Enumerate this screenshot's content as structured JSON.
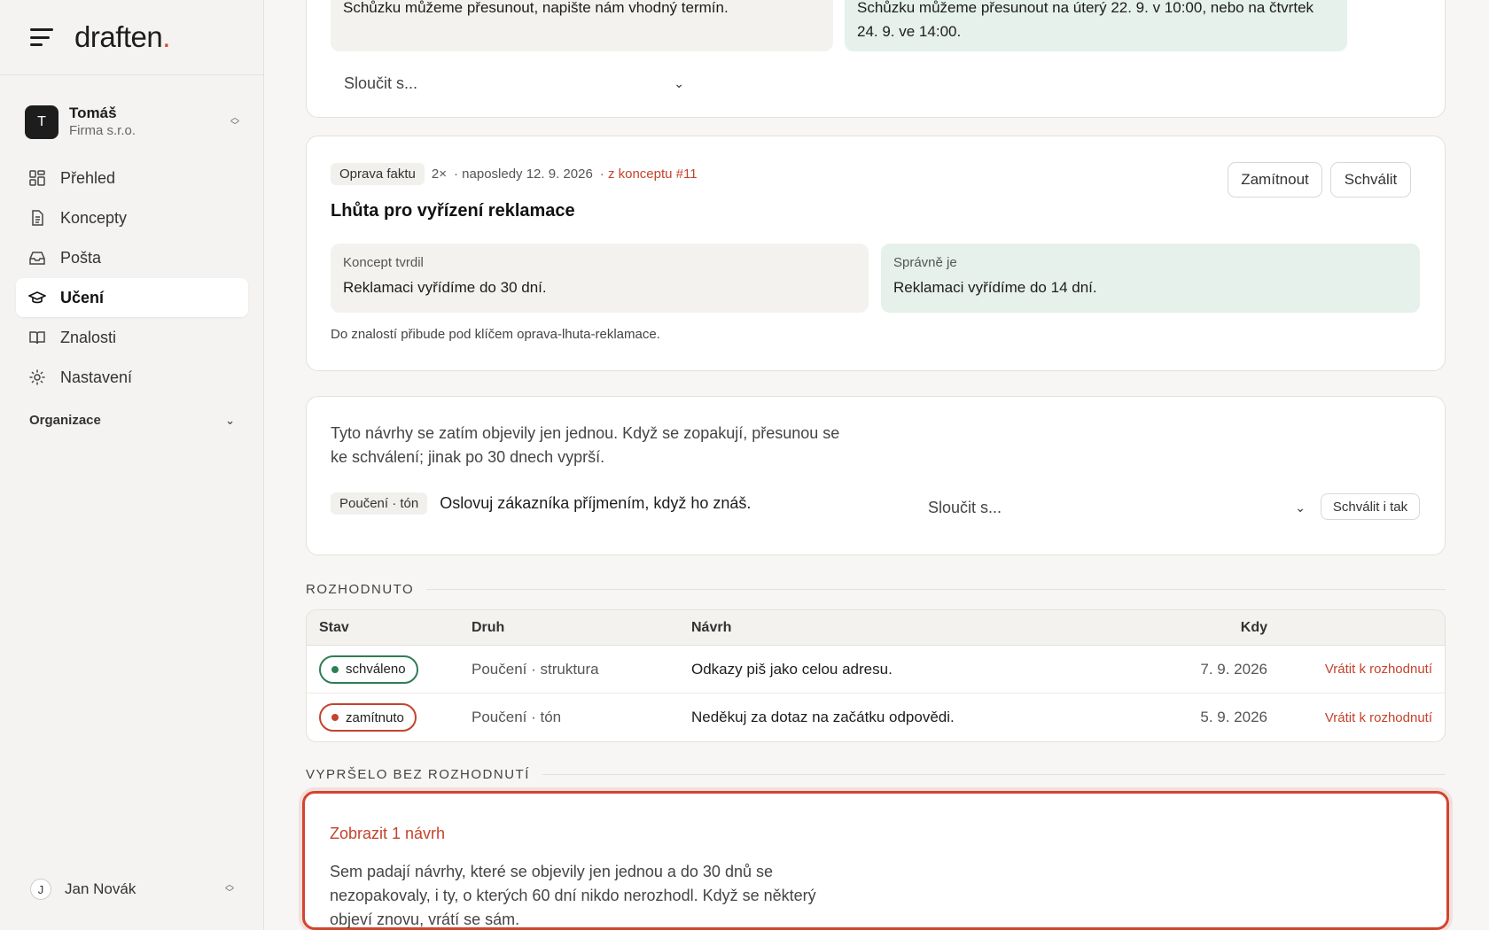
{
  "brand": {
    "name": "draften",
    "dot": "."
  },
  "account": {
    "initial": "T",
    "name": "Tomáš",
    "org": "Firma s.r.o."
  },
  "nav": [
    {
      "label": "Přehled",
      "icon": "dashboard-icon"
    },
    {
      "label": "Koncepty",
      "icon": "document-icon"
    },
    {
      "label": "Pošta",
      "icon": "inbox-icon"
    },
    {
      "label": "Učení",
      "icon": "graduation-cap-icon",
      "active": true
    },
    {
      "label": "Znalosti",
      "icon": "book-icon"
    },
    {
      "label": "Nastavení",
      "icon": "gear-icon"
    }
  ],
  "organization": {
    "label": "Organizace"
  },
  "user": {
    "initial": "J",
    "name": "Jan Novák"
  },
  "card_top": {
    "left_text": "Schůzku můžeme přesunout, napište nám vhodný termín.",
    "right_text": "Schůzku můžeme přesunout na úterý 22. 9. v 10:00, nebo na čtvrtek 24. 9. ve 14:00.",
    "merge_label": "Sloučit s..."
  },
  "card_fact": {
    "tag": "Oprava faktu",
    "count": "2×",
    "last": "· naposledy 12. 9. 2026",
    "source": "· z konceptu #11",
    "title": "Lhůta pro vyřízení reklamace",
    "left_label": "Koncept tvrdil",
    "left_text": "Reklamaci vyřídíme do 30 dní.",
    "right_label": "Správně je",
    "right_text": "Reklamaci vyřídíme do 14 dní.",
    "note": "Do znalostí přibude pod klíčem oprava-lhuta-reklamace.",
    "reject_label": "Zamítnout",
    "approve_label": "Schválit"
  },
  "card_single": {
    "intro_line1": "Tyto návrhy se zatím objevily jen jednou. Když se zopakují, přesunou se",
    "intro_line2": "ke schválení; jinak po 30 dnech vyprší.",
    "tag": "Poučení · tón",
    "text": "Oslovuj zákazníka příjmením, když ho znáš.",
    "merge_label": "Sloučit s...",
    "approve_label": "Schválit i tak"
  },
  "decided": {
    "title": "ROZHODNUTO",
    "headers": {
      "stav": "Stav",
      "druh": "Druh",
      "navrh": "Návrh",
      "kdy": "Kdy"
    },
    "rows": [
      {
        "stav": "schváleno",
        "druh": "Poučení · struktura",
        "navrh": "Odkazy piš jako celou adresu.",
        "kdy": "7. 9. 2026",
        "action": "Vrátit k rozhodnutí"
      },
      {
        "stav": "zamítnuto",
        "druh": "Poučení · tón",
        "navrh": "Neděkuj za dotaz na začátku odpovědi.",
        "kdy": "5. 9. 2026",
        "action": "Vrátit k rozhodnutí"
      }
    ]
  },
  "expired": {
    "title": "VYPRŠELO BEZ ROZHODNUTÍ",
    "toggle": "Zobrazit 1 návrh",
    "line1": "Sem padají návrhy, které se objevily jen jednou a do 30 dnů se",
    "line2": "nezopakovaly, i ty, o kterých 60 dní nikdo nerozhodl. Když se některý",
    "line3": "objeví znovu, vrátí se sám."
  },
  "colors": {
    "accent": "#d2452f",
    "approved": "#2f7d55",
    "rejected": "#c4432c",
    "green_box": "#e5f1ea"
  }
}
